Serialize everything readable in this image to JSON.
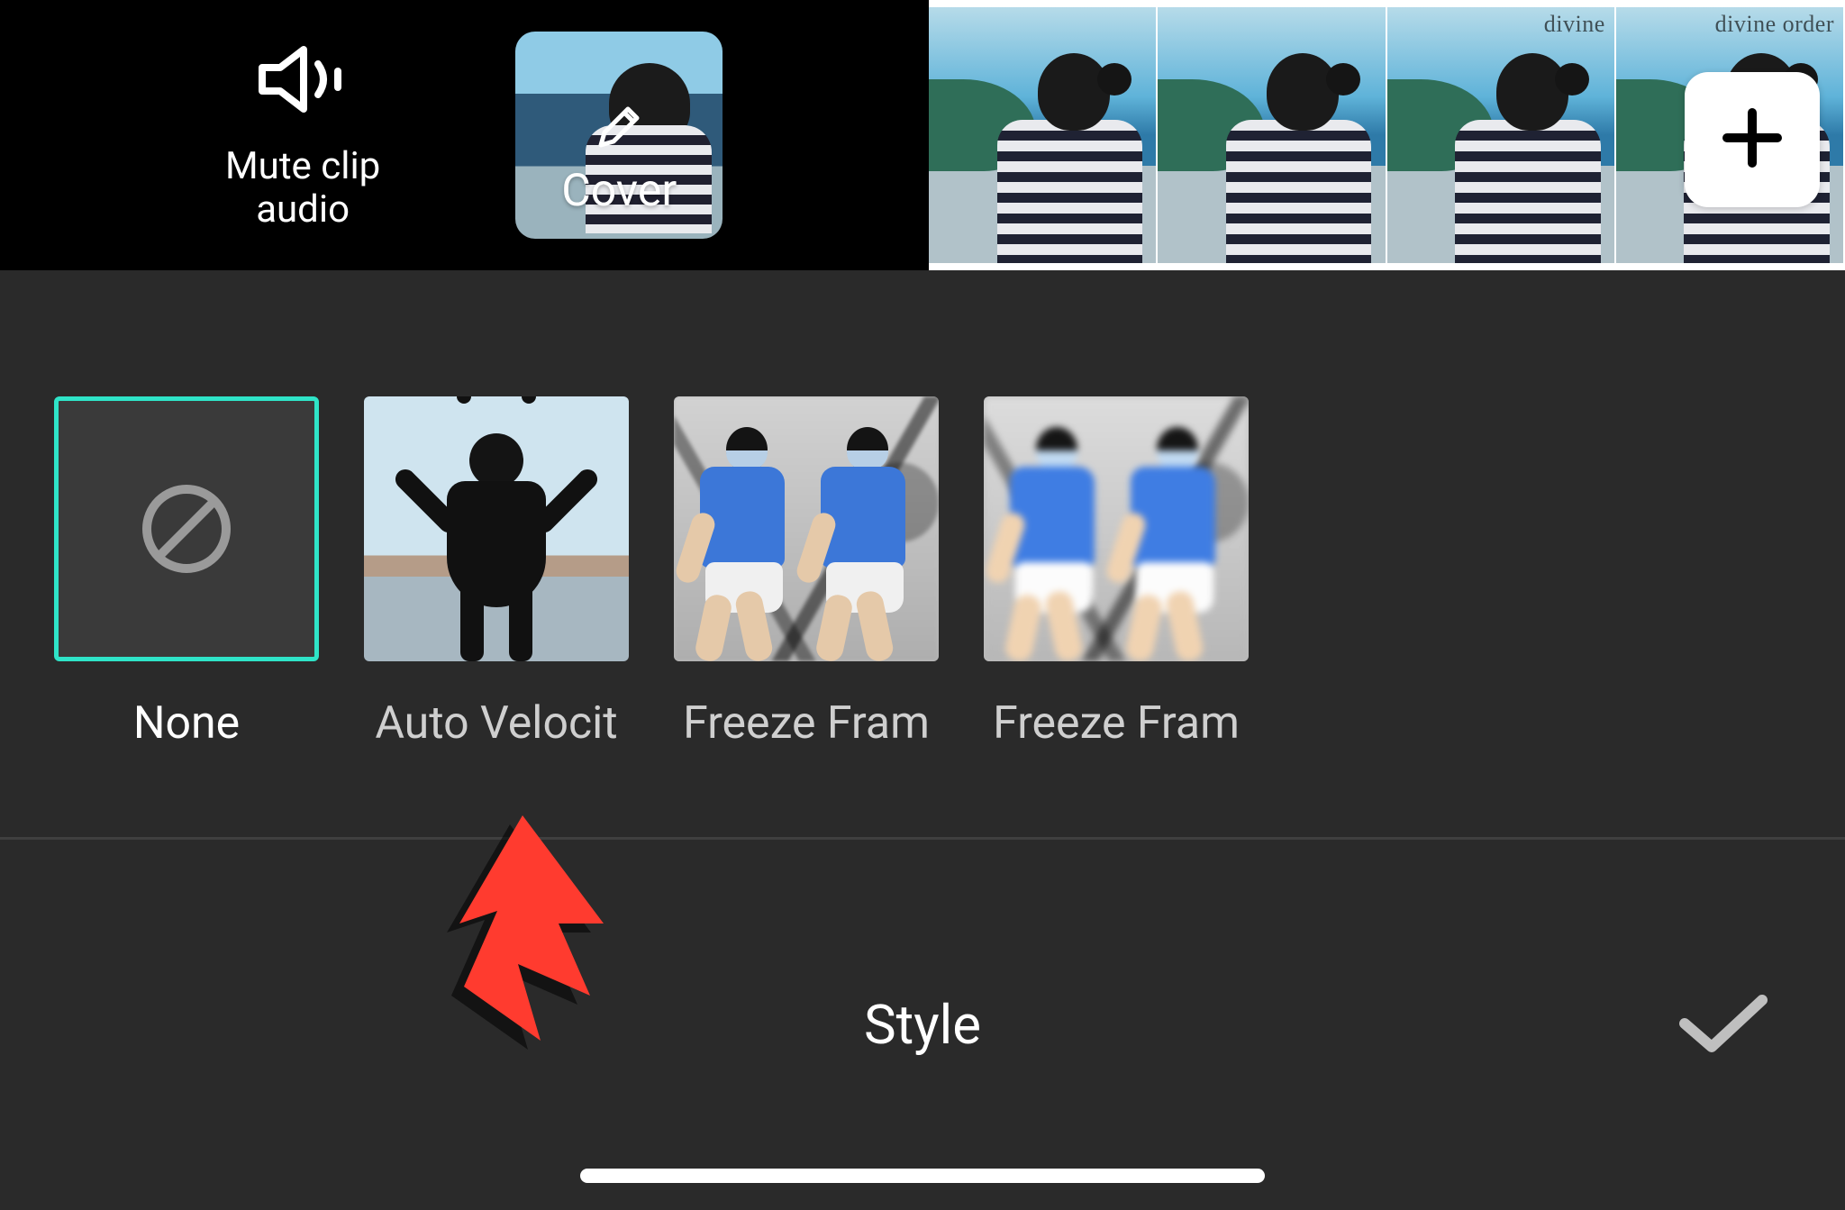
{
  "toolbar": {
    "mute_clip_audio_label": "Mute clip\naudio",
    "cover_label": "Cover"
  },
  "timeline": {
    "frame_overlays": [
      "",
      "",
      "divine",
      "divine order"
    ]
  },
  "effects": {
    "items": [
      {
        "label": "None",
        "selected": true
      },
      {
        "label": "Auto Velocit",
        "selected": false
      },
      {
        "label": "Freeze Fram",
        "selected": false
      },
      {
        "label": "Freeze Fram",
        "selected": false
      }
    ]
  },
  "panel": {
    "title": "Style"
  },
  "colors": {
    "accent": "#2fe4c8",
    "annotation_arrow": "#ff3b2f"
  }
}
